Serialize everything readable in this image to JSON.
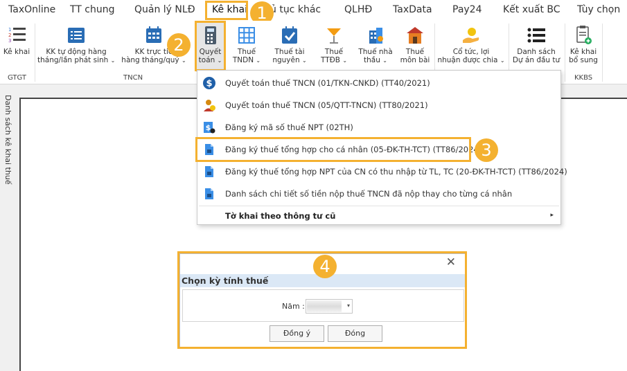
{
  "menu": {
    "tabs": [
      {
        "label": "TaxOnline"
      },
      {
        "label": "TT chung"
      },
      {
        "label": "Quản lý NLĐ"
      },
      {
        "label": "Kê khai"
      },
      {
        "label": "ủ tục khác"
      },
      {
        "label": "QLHĐ"
      },
      {
        "label": "TaxData"
      },
      {
        "label": "Pay24"
      },
      {
        "label": "Kết xuất BC"
      },
      {
        "label": "Tùy chọn"
      }
    ]
  },
  "ribbon": {
    "buttons": [
      {
        "line1": "Kê khai",
        "line2": ""
      },
      {
        "line1": "KK tự động hàng",
        "line2": "tháng/lần phát sinh"
      },
      {
        "line1": "KK trực tiế",
        "line2": "hàng tháng/quý"
      },
      {
        "line1": "Quyết",
        "line2": "toán"
      },
      {
        "line1": "Thuế",
        "line2": "TNDN"
      },
      {
        "line1": "Thuế tài",
        "line2": "nguyên"
      },
      {
        "line1": "Thuế",
        "line2": "TTĐB"
      },
      {
        "line1": "Thuế nhà",
        "line2": "thầu"
      },
      {
        "line1": "Thuế",
        "line2": "môn bài"
      },
      {
        "line1": "Cổ tức, lợi",
        "line2": "nhuận được chia"
      },
      {
        "line1": "Danh sách",
        "line2": "Dự án đầu tư"
      },
      {
        "line1": "Kê khai",
        "line2": "bổ sung"
      }
    ],
    "groups": [
      "GTGT",
      "TNCN",
      "KKBS"
    ],
    "chevron": "⌄"
  },
  "side_panel": {
    "label": "Danh sách kê khai thuế"
  },
  "dropdown": {
    "items": [
      {
        "label": "Quyết toán thuế TNCN (01/TKN-CNKD) (TT40/2021)"
      },
      {
        "label": "Quyết toán thuế TNCN (05/QTT-TNCN) (TT80/2021)"
      },
      {
        "label": "Đăng ký mã số thuế NPT (02TH)"
      },
      {
        "label": "Đăng ký thuế tổng hợp cho cá nhân (05-ĐK-TH-TCT) (TT86/2024)"
      },
      {
        "label": "Đăng ký thuế tổng hợp NPT của CN có thu nhập từ TL, TC (20-ĐK-TH-TCT) (TT86/2024)"
      },
      {
        "label": "Danh sách chi tiết số tiền nộp thuế TNCN đã nộp thay cho từng cá nhân"
      }
    ],
    "submenu": "Tờ khai theo thông tư cũ",
    "submenu_arrow": "▸"
  },
  "dialog": {
    "title": "Chọn kỳ tính thuế",
    "close": "✕",
    "year_label": "Năm :",
    "combo_arrow": "▾",
    "ok": "Đồng ý",
    "cancel": "Đóng"
  },
  "badges": [
    "1",
    "2",
    "3",
    "4"
  ],
  "colors": {
    "highlight": "#f4b130",
    "dialog_title_bg": "#dbe8f6"
  }
}
